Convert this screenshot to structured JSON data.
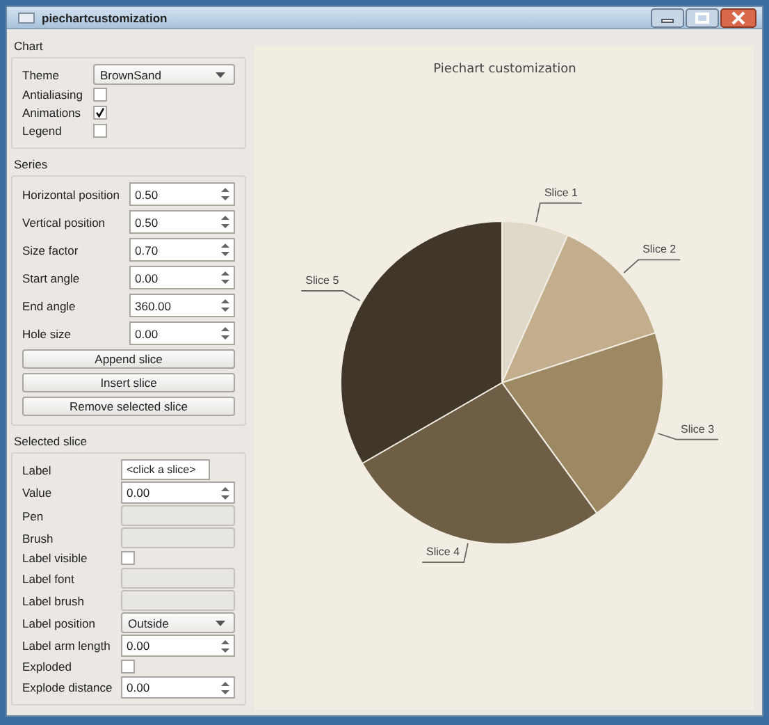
{
  "window": {
    "title": "piechartcustomization"
  },
  "groups": [
    {
      "title": "Chart",
      "rows": [
        {
          "kind": "combo",
          "label": "Theme",
          "value": "BrownSand"
        },
        {
          "kind": "check",
          "label": "Antialiasing",
          "checked": false
        },
        {
          "kind": "check",
          "label": "Animations",
          "checked": true
        },
        {
          "kind": "check",
          "label": "Legend",
          "checked": false
        }
      ]
    },
    {
      "title": "Series",
      "rows": [
        {
          "kind": "spin",
          "label": "Horizontal position",
          "value": "0.50"
        },
        {
          "kind": "spin",
          "label": "Vertical position",
          "value": "0.50"
        },
        {
          "kind": "spin",
          "label": "Size factor",
          "value": "0.70"
        },
        {
          "kind": "spin",
          "label": "Start angle",
          "value": "0.00"
        },
        {
          "kind": "spin",
          "label": "End angle",
          "value": "360.00"
        },
        {
          "kind": "spin",
          "label": "Hole size",
          "value": "0.00"
        },
        {
          "kind": "button",
          "label": "Append slice"
        },
        {
          "kind": "button",
          "label": "Insert slice"
        },
        {
          "kind": "button",
          "label": "Remove selected slice"
        }
      ]
    },
    {
      "title": "Selected slice",
      "rows": [
        {
          "kind": "text",
          "label": "Label",
          "value": "<click a slice>"
        },
        {
          "kind": "spin",
          "label": "Value",
          "value": "0.00"
        },
        {
          "kind": "empty",
          "label": "Pen"
        },
        {
          "kind": "empty",
          "label": "Brush"
        },
        {
          "kind": "check",
          "label": "Label visible",
          "checked": false
        },
        {
          "kind": "empty",
          "label": "Label font"
        },
        {
          "kind": "empty",
          "label": "Label brush"
        },
        {
          "kind": "combo",
          "label": "Label position",
          "value": "Outside"
        },
        {
          "kind": "spin",
          "label": "Label arm length",
          "value": "0.00"
        },
        {
          "kind": "check",
          "label": "Exploded",
          "checked": false
        },
        {
          "kind": "spin",
          "label": "Explode distance",
          "value": "0.00"
        }
      ]
    }
  ],
  "chart": {
    "chart_data": {
      "type": "pie",
      "title": "Piechart customization",
      "categories": [
        "Slice 1",
        "Slice 2",
        "Slice 3",
        "Slice 4",
        "Slice 5"
      ],
      "values": [
        1,
        2,
        3,
        4,
        5
      ],
      "colors": [
        "#e0d8c8",
        "#c2ae8c",
        "#9c8963",
        "#6d5e45",
        "#40362a"
      ]
    }
  }
}
